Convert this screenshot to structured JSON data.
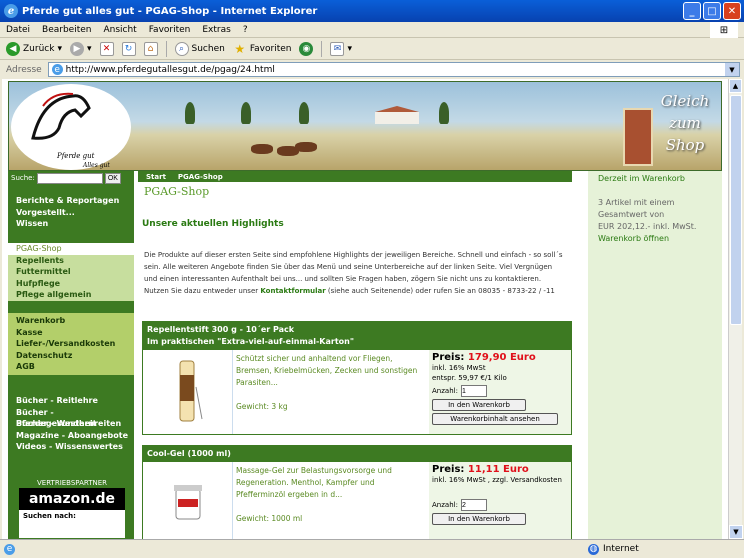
{
  "window": {
    "title": "Pferde gut alles gut - PGAG-Shop - Internet Explorer",
    "min": "_",
    "max": "□",
    "close": "✕"
  },
  "menu": [
    "Datei",
    "Bearbeiten",
    "Ansicht",
    "Favoriten",
    "Extras",
    "?"
  ],
  "toolbar": {
    "back": "Zurück",
    "search": "Suchen",
    "favorites": "Favoriten"
  },
  "address": {
    "label": "Adresse",
    "url": "http://www.pferdegutallesgut.de/pgag/24.html"
  },
  "status": {
    "zone": "Internet"
  },
  "site": {
    "logo_text": "Pferde gut",
    "logo_text2": "Alles gut",
    "banner": [
      "Gleich",
      "zum",
      "Shop"
    ],
    "search_label": "Suche:",
    "search_btn": "OK",
    "nav1": [
      "Berichte & Reportagen",
      "Vorgestellt...",
      "Wissen"
    ],
    "nav2_head": "PGAG-Shop",
    "nav2": [
      "Repellents",
      "Futtermittel",
      "Hufpflege",
      "Pflege allgemein"
    ],
    "nav3": [
      "Warenkorb",
      "Kasse",
      "Liefer-/Versandkosten",
      "Datenschutz",
      "AGB"
    ],
    "nav4": [
      "Bücher - Reitlehre",
      "Bücher - Pferdegesundheit",
      "Bücher - Westernreiten",
      "Magazine - Aboangebote",
      "Videos - Wissenswertes"
    ],
    "vertrieb": "VERTRIEBSPARTNER",
    "amazon": "amazon.de",
    "suchen": "Suchen nach:",
    "crumb": [
      "Start",
      "PGAG-Shop"
    ],
    "page_title": "PGAG-Shop",
    "highlights": "Unsere aktuellen Highlights",
    "intro1": "Die Produkte auf dieser ersten Seite sind empfohlene Highlights der jeweiligen Bereiche. Schnell und einfach - so soll´s",
    "intro2": "sein. Alle weiteren Angebote finden Sie über das Menü und seine Unterbereiche auf der linken Seite. Viel Vergnügen",
    "intro3": "und einen interessanten Aufenthalt bei uns... und sollten Sie Fragen haben, zögern Sie nicht uns zu kontaktieren.",
    "intro4a": "Nutzen Sie dazu entweder unser ",
    "intro4link": "Kontaktformular",
    "intro4b": " (siehe auch Seitenende) oder rufen Sie an 08035 - 8733-22 / -11",
    "p1": {
      "title": "Repellentstift 300 g - 10´er Pack",
      "subtitle": "Im praktischen \"Extra-viel-auf-einmal-Karton\"",
      "desc": "Schützt sicher und anhaltend vor Fliegen, Bremsen, Kriebelmücken, Zecken und sonstigen Parasiten...",
      "weight": "Gewicht: 3 kg",
      "price_label": "Preis: ",
      "price": "179,90 Euro",
      "tax": "inkl. 16% MwSt",
      "per": "entspr. 59,97 €/1 Kilo",
      "amt_label": "Anzahl:",
      "amt": "1",
      "cart": "In den Warenkorb",
      "view": "Warenkorbinhalt ansehen"
    },
    "p2": {
      "title": "Cool-Gel (1000 ml)",
      "desc": "Massage-Gel zur Belastungsvorsorge und Regeneration. Menthol, Kampfer und Pfefferminzöl ergeben in d...",
      "weight": "Gewicht: 1000 ml",
      "price_label": "Preis: ",
      "price": "11,11 Euro",
      "tax": "inkl. 16% MwSt , zzgl. Versandkosten",
      "amt_label": "Anzahl:",
      "amt": "2",
      "cart": "In den Warenkorb"
    },
    "right": {
      "head": "Derzeit im Warenkorb",
      "l1": "3 Artikel mit einem",
      "l2": "Gesamtwert von",
      "l3": "EUR 202,12.- inkl. MwSt.",
      "link": "Warenkorb öffnen"
    }
  }
}
